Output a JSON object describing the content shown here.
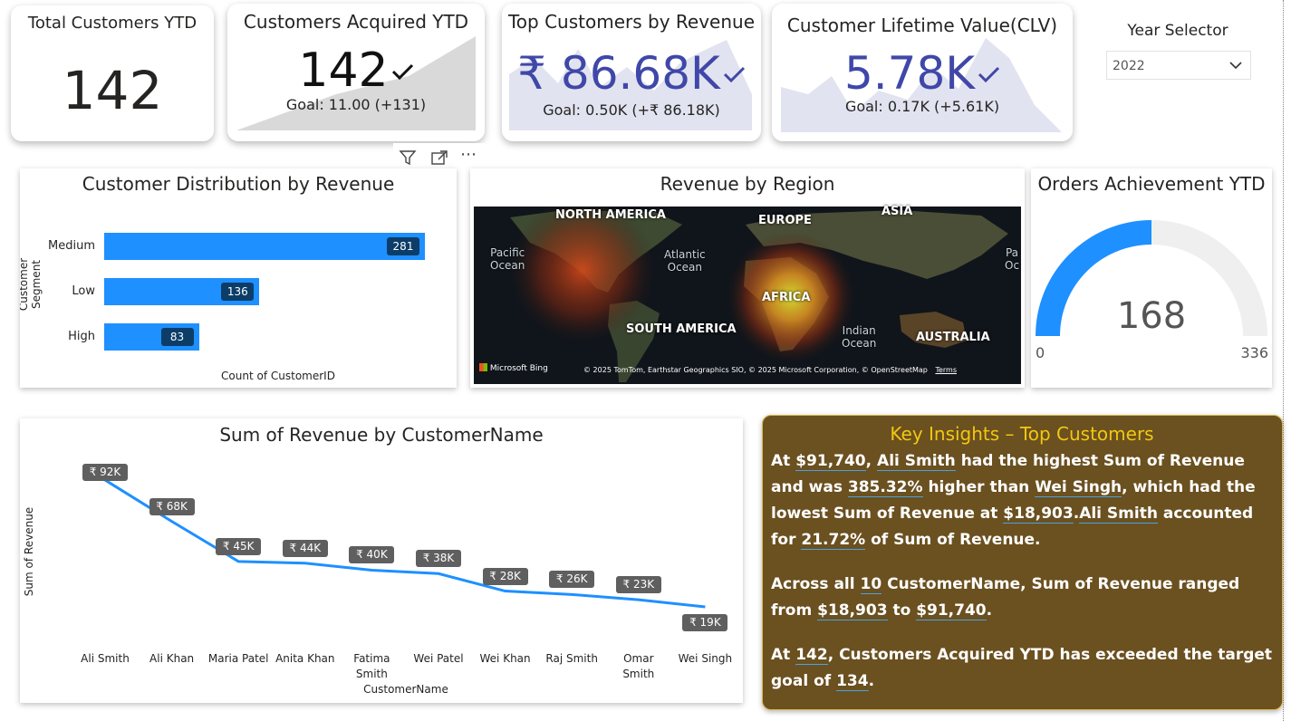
{
  "kpi": {
    "total": {
      "title": "Total Customers YTD",
      "value": "142"
    },
    "acquired": {
      "title": "Customers Acquired YTD",
      "value": "142",
      "goal": "Goal: 11.00 (+131)"
    },
    "top": {
      "title": "Top Customers by Revenue",
      "value": "₹ 86.68K",
      "goal": "Goal: 0.50K (+₹ 86.18K)"
    },
    "clv": {
      "title": "Customer Lifetime Value(CLV)",
      "value": "5.78K",
      "goal": "Goal: 0.17K (+5.61K)"
    }
  },
  "year_selector": {
    "title": "Year Selector",
    "value": "2022"
  },
  "visual_header": {
    "filter": "filter-icon",
    "focus": "focus-mode-icon",
    "more": "more-options-icon"
  },
  "distribution": {
    "title": "Customer Distribution by Revenue",
    "ylabel": "Customer Segment",
    "xlabel": "Count of CustomerID",
    "categories": [
      "Medium",
      "Low",
      "High"
    ],
    "values": [
      281,
      136,
      83
    ],
    "max": 281
  },
  "map": {
    "title": "Revenue by Region",
    "continents": [
      "NORTH AMERICA",
      "EUROPE",
      "ASIA",
      "AFRICA",
      "SOUTH AMERICA",
      "AUSTRALIA"
    ],
    "oceans": [
      "Pacific\nOcean",
      "Atlantic\nOcean",
      "Indian\nOcean",
      "Pa\nOc"
    ],
    "brand": "Microsoft Bing",
    "copyright": "© 2025 TomTom, Earthstar Geographics SIO, © 2025 Microsoft Corporation, © OpenStreetMap",
    "terms": "Terms"
  },
  "gauge": {
    "title": "Orders Achievement YTD",
    "value": 168,
    "min": 0,
    "max": 336,
    "value_label": "168",
    "min_label": "0",
    "max_label": "336"
  },
  "chart_data": {
    "type": "line",
    "title": "Sum of Revenue by CustomerName",
    "xlabel": "CustomerName",
    "ylabel": "Sum of Revenue",
    "categories": [
      "Ali Smith",
      "Ali Khan",
      "Maria Patel",
      "Anita Khan",
      "Fatima Smith",
      "Wei Patel",
      "Wei Khan",
      "Raj Smith",
      "Omar Smith",
      "Wei Singh"
    ],
    "values": [
      91740,
      68000,
      45000,
      44000,
      40000,
      38000,
      28000,
      26000,
      23000,
      18903
    ],
    "data_labels": [
      "₹ 92K",
      "₹ 68K",
      "₹ 45K",
      "₹ 44K",
      "₹ 40K",
      "₹ 38K",
      "₹ 28K",
      "₹ 26K",
      "₹ 23K",
      "₹ 19K"
    ],
    "color": "#1e90ff"
  },
  "insights": {
    "title": "Key Insights – Top Customers",
    "p1": [
      {
        "t": "At "
      },
      {
        "t": "$91,740",
        "h": true
      },
      {
        "t": ", "
      },
      {
        "t": "Ali Smith",
        "h": true
      },
      {
        "t": " had the highest Sum of Revenue and was "
      },
      {
        "t": "385.32%",
        "h": true
      },
      {
        "t": " higher than "
      },
      {
        "t": "Wei Singh",
        "h": true
      },
      {
        "t": ", which had the lowest Sum of Revenue at "
      },
      {
        "t": "$18,903",
        "h": true
      },
      {
        "t": "."
      },
      {
        "t": "Ali Smith",
        "h": true
      },
      {
        "t": " accounted for "
      },
      {
        "t": "21.72%",
        "h": true
      },
      {
        "t": " of Sum of Revenue."
      }
    ],
    "p2": [
      {
        "t": "Across all "
      },
      {
        "t": "10",
        "h": true
      },
      {
        "t": " CustomerName, Sum of Revenue ranged from "
      },
      {
        "t": "$18,903",
        "h": true
      },
      {
        "t": " to "
      },
      {
        "t": "$91,740",
        "h": true
      },
      {
        "t": "."
      }
    ],
    "p3": [
      {
        "t": "At "
      },
      {
        "t": "142",
        "h": true
      },
      {
        "t": ", Customers Acquired YTD has exceeded the target goal of "
      },
      {
        "t": "134",
        "h": true
      },
      {
        "t": "."
      }
    ]
  },
  "colors": {
    "accent": "#1e90ff",
    "kpi_value": "#3f48a8",
    "insight_bg": "#6b5020",
    "insight_title": "#f2c811",
    "badge": "#0c3d68"
  }
}
